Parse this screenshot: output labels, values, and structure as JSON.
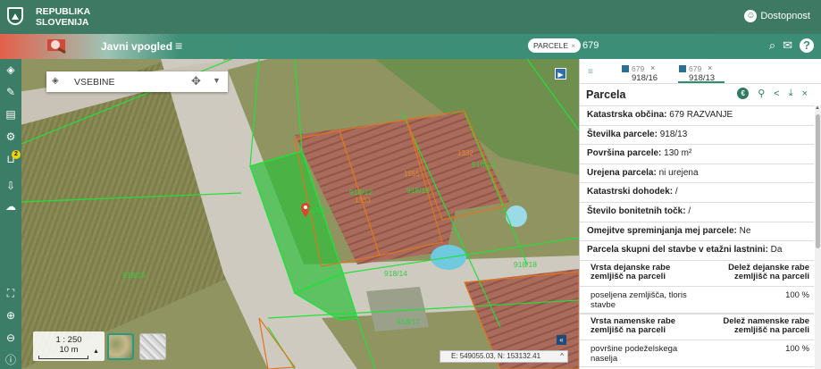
{
  "topbar": {
    "brand_line1": "REPUBLIKA",
    "brand_line2": "SLOVENIJA",
    "access_label": "Dostopnost"
  },
  "secbar": {
    "app_title": "Javni vpogled",
    "search_chip": "PARCELE",
    "search_value": "679"
  },
  "map": {
    "layers_label": "VSEBINE",
    "scale_ratio": "1 : 250",
    "scale_distance": "10 m",
    "coordinates": "E: 549055.03, N: 153132.41",
    "parcel_labels": [
      "918/13",
      "918/14",
      "918/15",
      "918/16",
      "918/17",
      "918/18",
      "918/10",
      "918/12",
      "1333",
      "1555",
      "1332"
    ]
  },
  "panel": {
    "tabs": [
      {
        "line1": "679",
        "line2": "918/16"
      },
      {
        "line1": "679",
        "line2": "918/13"
      }
    ],
    "title": "Parcela",
    "rows": [
      {
        "label": "Katastrska občina:",
        "value": "679 RAZVANJE"
      },
      {
        "label": "Številka parcele:",
        "value": "918/13"
      },
      {
        "label": "Površina parcele:",
        "value": "130 m²"
      },
      {
        "label": "Urejena parcela:",
        "value": "ni urejena"
      },
      {
        "label": "Katastrski dohodek:",
        "value": "/"
      },
      {
        "label": "Število bonitetnih točk:",
        "value": "/"
      },
      {
        "label": "Omejitve spreminjanja mej parcele:",
        "value": "Ne"
      },
      {
        "label": "Parcela skupni del stavbe v etažni lastnini:",
        "value": "Da"
      }
    ],
    "table1": {
      "h1": "Vrsta dejanske rabe zemljišč na parceli",
      "h2": "Delež dejanske rabe zemljišč na parceli",
      "rows": [
        {
          "name": "poseljena zemljišča, tloris stavbe",
          "share": "100 %"
        }
      ]
    },
    "table2": {
      "h1": "Vrsta namenske rabe zemljišč na parceli",
      "h2": "Delež namenske rabe zemljišč na parceli",
      "rows": [
        {
          "name": "površine podeželskega naselja",
          "share": "100 %"
        }
      ]
    }
  },
  "colors": {
    "header": "#3e7a63",
    "accent": "#2e8f6c",
    "parcel_line": "#21e03a",
    "selected_fill": "#2dbf3a",
    "building_line": "#e07420"
  }
}
